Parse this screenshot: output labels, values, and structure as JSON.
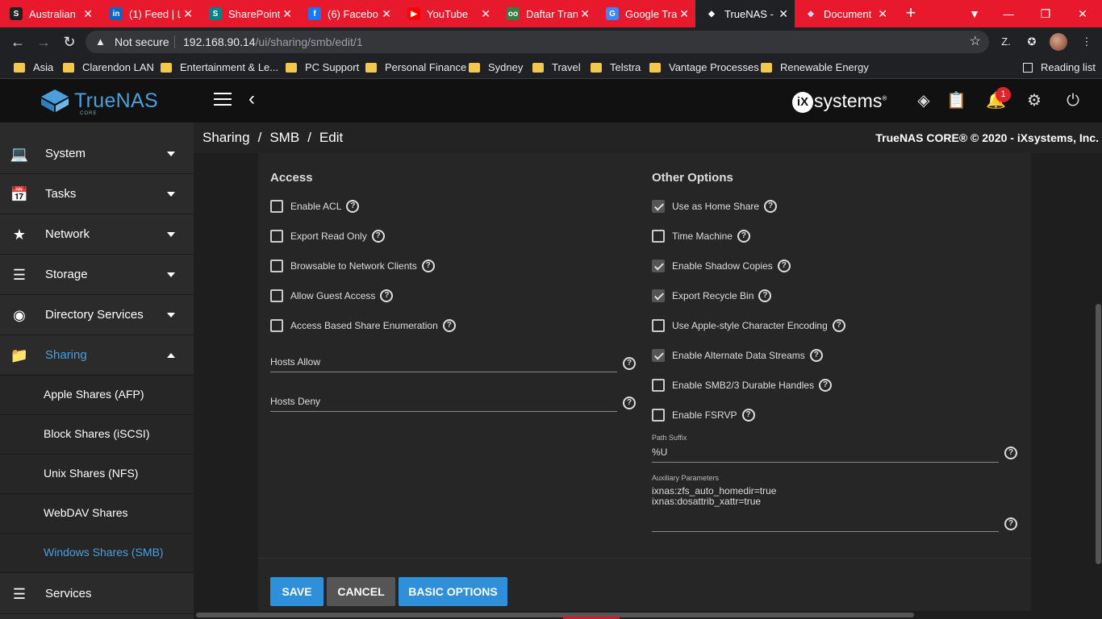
{
  "browser": {
    "tabs": [
      {
        "title": "Australian",
        "fav": "S",
        "fav_bg": "#222",
        "fav_fg": "#fff"
      },
      {
        "title": "(1) Feed | L",
        "fav": "in",
        "fav_bg": "#0a66c2",
        "fav_fg": "#fff"
      },
      {
        "title": "SharePoint",
        "fav": "S",
        "fav_bg": "#038387",
        "fav_fg": "#fff"
      },
      {
        "title": "(6) Facebo",
        "fav": "f",
        "fav_bg": "#1877f2",
        "fav_fg": "#fff"
      },
      {
        "title": "YouTube",
        "fav": "▶",
        "fav_bg": "#ff0000",
        "fav_fg": "#fff"
      },
      {
        "title": "Daftar Tran",
        "fav": "oo",
        "fav_bg": "#3a7d44",
        "fav_fg": "#fff"
      },
      {
        "title": "Google Tra",
        "fav": "G",
        "fav_bg": "#4285f4",
        "fav_fg": "#fff"
      },
      {
        "title": "TrueNAS -",
        "fav": "◆",
        "fav_bg": "#202124",
        "fav_fg": "#fff"
      },
      {
        "title": "Document",
        "fav": "◆",
        "fav_bg": "#e8192c",
        "fav_fg": "#c9d6ff"
      }
    ],
    "new_tab": "+",
    "address": {
      "security": "Not secure",
      "host": "192.168.90.14",
      "path": "/ui/sharing/smb/edit/1"
    },
    "bookmarks": [
      "Asia",
      "Clarendon LAN",
      "Entertainment & Le...",
      "PC Support",
      "Personal Finance",
      "Sydney",
      "Travel",
      "Telstra",
      "Vantage Processes",
      "Renewable Energy"
    ],
    "reading_list": "Reading list"
  },
  "topbar": {
    "brand": "TrueNAS",
    "brand_sub": "CORE",
    "vendor": "systems",
    "vendor_mark": "iX",
    "notifications_count": "1"
  },
  "sidebar": {
    "items": [
      {
        "label": "System",
        "icon": "monitor-icon"
      },
      {
        "label": "Tasks",
        "icon": "calendar-icon"
      },
      {
        "label": "Network",
        "icon": "network-icon"
      },
      {
        "label": "Storage",
        "icon": "storage-icon"
      },
      {
        "label": "Directory Services",
        "icon": "directory-icon"
      },
      {
        "label": "Sharing",
        "icon": "folder-shared-icon"
      }
    ],
    "sub_items": [
      "Apple Shares (AFP)",
      "Block Shares (iSCSI)",
      "Unix Shares (NFS)",
      "WebDAV Shares",
      "Windows Shares (SMB)"
    ],
    "services": "Services"
  },
  "breadcrumb": {
    "a": "Sharing",
    "b": "SMB",
    "c": "Edit",
    "sep": "/"
  },
  "copyright": "TrueNAS CORE® © 2020 - iXsystems, Inc.",
  "access": {
    "heading": "Access",
    "options": [
      {
        "label": "Enable ACL",
        "checked": false
      },
      {
        "label": "Export Read Only",
        "checked": false
      },
      {
        "label": "Browsable to Network Clients",
        "checked": false
      },
      {
        "label": "Allow Guest Access",
        "checked": false
      },
      {
        "label": "Access Based Share Enumeration",
        "checked": false
      }
    ],
    "hosts_allow": "Hosts Allow",
    "hosts_deny": "Hosts Deny"
  },
  "other": {
    "heading": "Other Options",
    "options": [
      {
        "label": "Use as Home Share",
        "checked": true
      },
      {
        "label": "Time Machine",
        "checked": false
      },
      {
        "label": "Enable Shadow Copies",
        "checked": true
      },
      {
        "label": "Export Recycle Bin",
        "checked": true
      },
      {
        "label": "Use Apple-style Character Encoding",
        "checked": false
      },
      {
        "label": "Enable Alternate Data Streams",
        "checked": true
      },
      {
        "label": "Enable SMB2/3 Durable Handles",
        "checked": false
      },
      {
        "label": "Enable FSRVP",
        "checked": false
      }
    ],
    "path_suffix_label": "Path Suffix",
    "path_suffix_value": "%U",
    "aux_label": "Auxiliary Parameters",
    "aux_value": "ixnas:zfs_auto_homedir=true\nixnas:dosattrib_xattr=true"
  },
  "buttons": {
    "save": "SAVE",
    "cancel": "CANCEL",
    "basic": "BASIC OPTIONS"
  },
  "colors": {
    "accent": "#4a9fdb",
    "button_primary": "#2f8fd8",
    "button_secondary": "#555555",
    "tabstrip": "#e8192c"
  }
}
